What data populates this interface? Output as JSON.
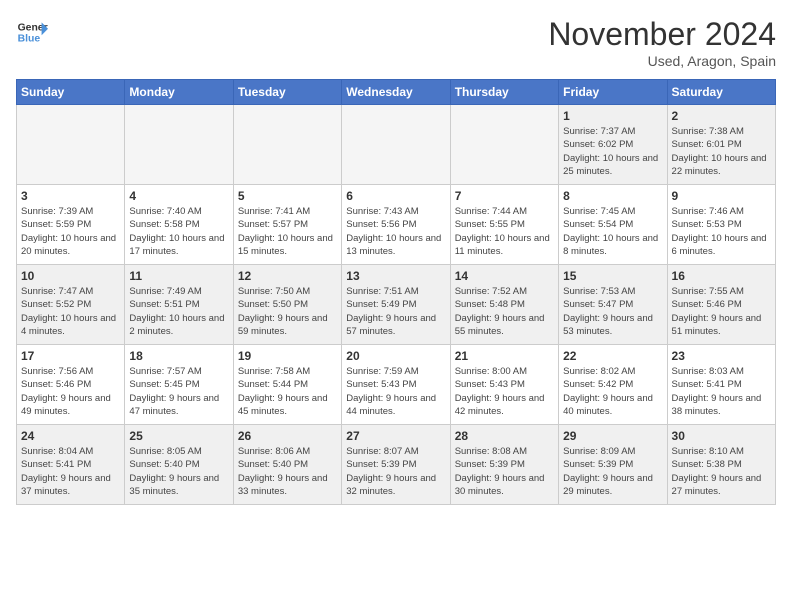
{
  "header": {
    "logo_general": "General",
    "logo_blue": "Blue",
    "month_title": "November 2024",
    "location": "Used, Aragon, Spain"
  },
  "days_of_week": [
    "Sunday",
    "Monday",
    "Tuesday",
    "Wednesday",
    "Thursday",
    "Friday",
    "Saturday"
  ],
  "weeks": [
    [
      {
        "day": "",
        "info": ""
      },
      {
        "day": "",
        "info": ""
      },
      {
        "day": "",
        "info": ""
      },
      {
        "day": "",
        "info": ""
      },
      {
        "day": "",
        "info": ""
      },
      {
        "day": "1",
        "info": "Sunrise: 7:37 AM\nSunset: 6:02 PM\nDaylight: 10 hours and 25 minutes."
      },
      {
        "day": "2",
        "info": "Sunrise: 7:38 AM\nSunset: 6:01 PM\nDaylight: 10 hours and 22 minutes."
      }
    ],
    [
      {
        "day": "3",
        "info": "Sunrise: 7:39 AM\nSunset: 5:59 PM\nDaylight: 10 hours and 20 minutes."
      },
      {
        "day": "4",
        "info": "Sunrise: 7:40 AM\nSunset: 5:58 PM\nDaylight: 10 hours and 17 minutes."
      },
      {
        "day": "5",
        "info": "Sunrise: 7:41 AM\nSunset: 5:57 PM\nDaylight: 10 hours and 15 minutes."
      },
      {
        "day": "6",
        "info": "Sunrise: 7:43 AM\nSunset: 5:56 PM\nDaylight: 10 hours and 13 minutes."
      },
      {
        "day": "7",
        "info": "Sunrise: 7:44 AM\nSunset: 5:55 PM\nDaylight: 10 hours and 11 minutes."
      },
      {
        "day": "8",
        "info": "Sunrise: 7:45 AM\nSunset: 5:54 PM\nDaylight: 10 hours and 8 minutes."
      },
      {
        "day": "9",
        "info": "Sunrise: 7:46 AM\nSunset: 5:53 PM\nDaylight: 10 hours and 6 minutes."
      }
    ],
    [
      {
        "day": "10",
        "info": "Sunrise: 7:47 AM\nSunset: 5:52 PM\nDaylight: 10 hours and 4 minutes."
      },
      {
        "day": "11",
        "info": "Sunrise: 7:49 AM\nSunset: 5:51 PM\nDaylight: 10 hours and 2 minutes."
      },
      {
        "day": "12",
        "info": "Sunrise: 7:50 AM\nSunset: 5:50 PM\nDaylight: 9 hours and 59 minutes."
      },
      {
        "day": "13",
        "info": "Sunrise: 7:51 AM\nSunset: 5:49 PM\nDaylight: 9 hours and 57 minutes."
      },
      {
        "day": "14",
        "info": "Sunrise: 7:52 AM\nSunset: 5:48 PM\nDaylight: 9 hours and 55 minutes."
      },
      {
        "day": "15",
        "info": "Sunrise: 7:53 AM\nSunset: 5:47 PM\nDaylight: 9 hours and 53 minutes."
      },
      {
        "day": "16",
        "info": "Sunrise: 7:55 AM\nSunset: 5:46 PM\nDaylight: 9 hours and 51 minutes."
      }
    ],
    [
      {
        "day": "17",
        "info": "Sunrise: 7:56 AM\nSunset: 5:46 PM\nDaylight: 9 hours and 49 minutes."
      },
      {
        "day": "18",
        "info": "Sunrise: 7:57 AM\nSunset: 5:45 PM\nDaylight: 9 hours and 47 minutes."
      },
      {
        "day": "19",
        "info": "Sunrise: 7:58 AM\nSunset: 5:44 PM\nDaylight: 9 hours and 45 minutes."
      },
      {
        "day": "20",
        "info": "Sunrise: 7:59 AM\nSunset: 5:43 PM\nDaylight: 9 hours and 44 minutes."
      },
      {
        "day": "21",
        "info": "Sunrise: 8:00 AM\nSunset: 5:43 PM\nDaylight: 9 hours and 42 minutes."
      },
      {
        "day": "22",
        "info": "Sunrise: 8:02 AM\nSunset: 5:42 PM\nDaylight: 9 hours and 40 minutes."
      },
      {
        "day": "23",
        "info": "Sunrise: 8:03 AM\nSunset: 5:41 PM\nDaylight: 9 hours and 38 minutes."
      }
    ],
    [
      {
        "day": "24",
        "info": "Sunrise: 8:04 AM\nSunset: 5:41 PM\nDaylight: 9 hours and 37 minutes."
      },
      {
        "day": "25",
        "info": "Sunrise: 8:05 AM\nSunset: 5:40 PM\nDaylight: 9 hours and 35 minutes."
      },
      {
        "day": "26",
        "info": "Sunrise: 8:06 AM\nSunset: 5:40 PM\nDaylight: 9 hours and 33 minutes."
      },
      {
        "day": "27",
        "info": "Sunrise: 8:07 AM\nSunset: 5:39 PM\nDaylight: 9 hours and 32 minutes."
      },
      {
        "day": "28",
        "info": "Sunrise: 8:08 AM\nSunset: 5:39 PM\nDaylight: 9 hours and 30 minutes."
      },
      {
        "day": "29",
        "info": "Sunrise: 8:09 AM\nSunset: 5:39 PM\nDaylight: 9 hours and 29 minutes."
      },
      {
        "day": "30",
        "info": "Sunrise: 8:10 AM\nSunset: 5:38 PM\nDaylight: 9 hours and 27 minutes."
      }
    ]
  ]
}
